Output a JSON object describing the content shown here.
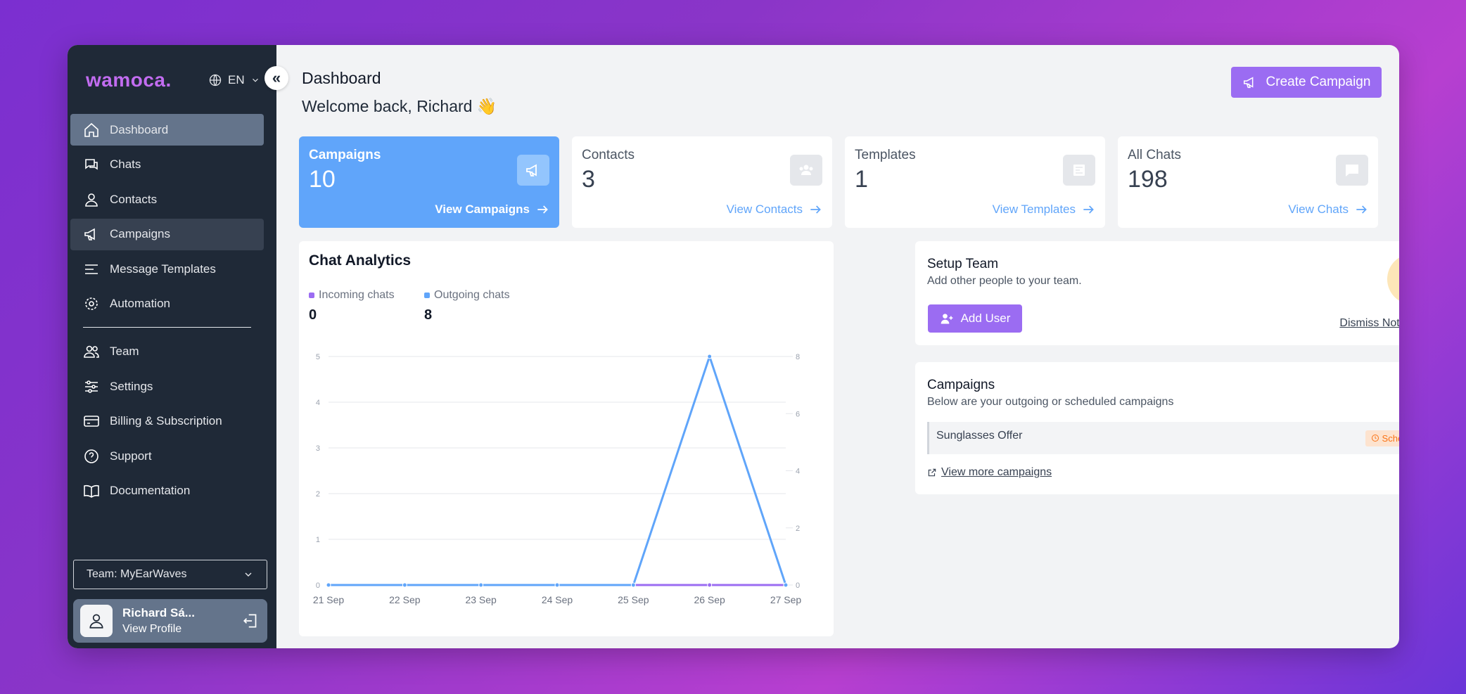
{
  "brand": {
    "logo": "wamoca.",
    "language": "EN",
    "accent": "#9b6cf2",
    "sidebar_bg": "#1f2937"
  },
  "sidebar": {
    "items": [
      {
        "label": "Dashboard",
        "icon": "home-icon"
      },
      {
        "label": "Chats",
        "icon": "chat-icon"
      },
      {
        "label": "Contacts",
        "icon": "user-icon"
      },
      {
        "label": "Campaigns",
        "icon": "megaphone-icon"
      },
      {
        "label": "Message Templates",
        "icon": "lines-icon"
      },
      {
        "label": "Automation",
        "icon": "gear-icon"
      },
      {
        "label": "Team",
        "icon": "team-icon"
      },
      {
        "label": "Settings",
        "icon": "sliders-icon"
      },
      {
        "label": "Billing & Subscription",
        "icon": "card-icon"
      },
      {
        "label": "Support",
        "icon": "help-icon"
      },
      {
        "label": "Documentation",
        "icon": "book-icon"
      }
    ],
    "team_select": "Team: MyEarWaves",
    "profile": {
      "name": "Richard Sá...",
      "link": "View Profile"
    }
  },
  "header": {
    "title": "Dashboard",
    "welcome": "Welcome back, Richard 👋",
    "create_button": "Create Campaign"
  },
  "stats": [
    {
      "label": "Campaigns",
      "value": "10",
      "link": "View Campaigns"
    },
    {
      "label": "Contacts",
      "value": "3",
      "link": "View Contacts"
    },
    {
      "label": "Templates",
      "value": "1",
      "link": "View Templates"
    },
    {
      "label": "All Chats",
      "value": "198",
      "link": "View Chats"
    }
  ],
  "analytics": {
    "title": "Chat Analytics",
    "incoming_label": "Incoming chats",
    "incoming_value": "0",
    "outgoing_label": "Outgoing chats",
    "outgoing_value": "8"
  },
  "chart_data": {
    "type": "line",
    "categories": [
      "21 Sep",
      "22 Sep",
      "23 Sep",
      "24 Sep",
      "25 Sep",
      "26 Sep",
      "27 Sep"
    ],
    "series": [
      {
        "name": "Incoming chats",
        "axis": "left",
        "color": "#9b6cf2",
        "values": [
          0,
          0,
          0,
          0,
          0,
          0,
          0
        ]
      },
      {
        "name": "Outgoing chats",
        "axis": "right",
        "color": "#60a5fa",
        "values": [
          0,
          0,
          0,
          0,
          0,
          8,
          0
        ]
      }
    ],
    "y_left": {
      "ticks": [
        0,
        1,
        2,
        3,
        4,
        5
      ],
      "lim": [
        0,
        5
      ]
    },
    "y_right": {
      "ticks": [
        0,
        2,
        4,
        6,
        8
      ],
      "lim": [
        0,
        8
      ]
    },
    "grid": true
  },
  "setup_team": {
    "title": "Setup Team",
    "subtitle": "Add other people to your team.",
    "add_button": "Add User",
    "dismiss": "Dismiss Notification"
  },
  "campaigns_panel": {
    "title": "Campaigns",
    "subtitle": "Below are your outgoing or scheduled campaigns",
    "items": [
      {
        "name": "Sunglasses Offer",
        "status": "Scheduled"
      }
    ],
    "view_more": "View more campaigns"
  }
}
